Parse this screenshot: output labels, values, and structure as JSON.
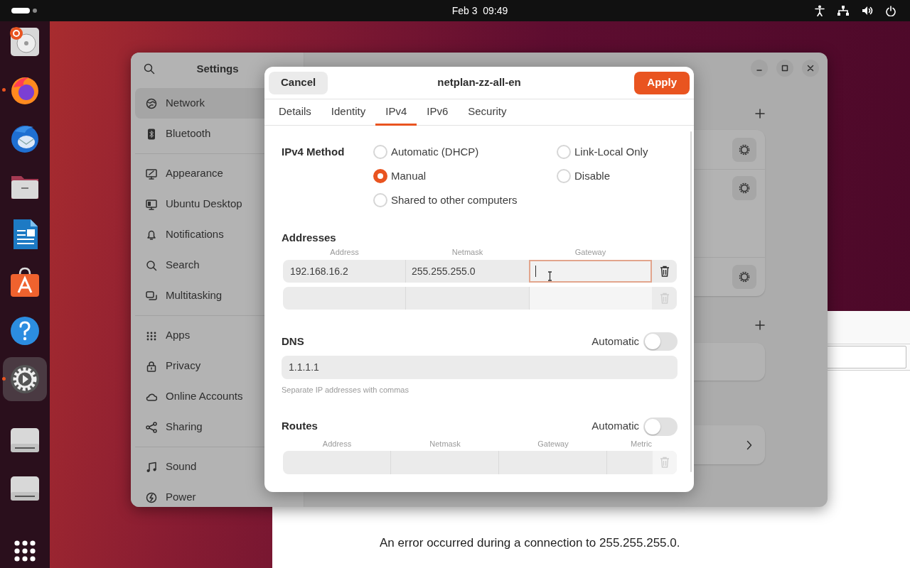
{
  "top_bar": {
    "clock": "Feb 3  09:49"
  },
  "dock": {
    "items": [
      {
        "kind": "installer",
        "running": false,
        "selected": false
      },
      {
        "kind": "browser",
        "running": true,
        "selected": false
      },
      {
        "kind": "mail",
        "running": false,
        "selected": false
      },
      {
        "kind": "files",
        "running": false,
        "selected": false
      },
      {
        "kind": "writer",
        "running": false,
        "selected": false
      },
      {
        "kind": "store",
        "running": false,
        "selected": false
      },
      {
        "kind": "help",
        "running": false,
        "selected": false
      },
      {
        "kind": "settings",
        "running": true,
        "selected": true
      },
      {
        "kind": "drive",
        "running": false,
        "selected": false
      },
      {
        "kind": "drive",
        "running": false,
        "selected": false
      }
    ]
  },
  "browser": {
    "message": "An error occurred during a connection to 255.255.255.0."
  },
  "settings": {
    "title": "Settings",
    "sidebar": {
      "groups": [
        [
          {
            "kind": "network",
            "label": "Network",
            "selected": true
          },
          {
            "kind": "bluetooth",
            "label": "Bluetooth",
            "selected": false
          }
        ],
        [
          {
            "kind": "appearance",
            "label": "Appearance",
            "selected": false
          },
          {
            "kind": "desktop",
            "label": "Ubuntu Desktop",
            "selected": false
          },
          {
            "kind": "notifications",
            "label": "Notifications",
            "selected": false
          },
          {
            "kind": "search",
            "label": "Search",
            "selected": false
          },
          {
            "kind": "multitasking",
            "label": "Multitasking",
            "selected": false
          }
        ],
        [
          {
            "kind": "apps",
            "label": "Apps",
            "selected": false
          },
          {
            "kind": "privacy",
            "label": "Privacy",
            "selected": false
          },
          {
            "kind": "accounts",
            "label": "Online Accounts",
            "selected": false
          },
          {
            "kind": "sharing",
            "label": "Sharing",
            "selected": false
          }
        ],
        [
          {
            "kind": "sound",
            "label": "Sound",
            "selected": false
          },
          {
            "kind": "power",
            "label": "Power",
            "selected": false
          }
        ]
      ]
    }
  },
  "dialog": {
    "cancel": "Cancel",
    "title": "netplan-zz-all-en",
    "apply": "Apply",
    "tabs": [
      {
        "label": "Details",
        "selected": false
      },
      {
        "label": "Identity",
        "selected": false
      },
      {
        "label": "IPv4",
        "selected": true
      },
      {
        "label": "IPv6",
        "selected": false
      },
      {
        "label": "Security",
        "selected": false
      }
    ],
    "method": {
      "label": "IPv4 Method",
      "options": [
        {
          "label": "Automatic (DHCP)",
          "selected": false
        },
        {
          "label": "Link-Local Only",
          "selected": false
        },
        {
          "label": "Manual",
          "selected": true
        },
        {
          "label": "Disable",
          "selected": false
        },
        {
          "label": "Shared to other computers",
          "selected": false
        }
      ]
    },
    "addresses": {
      "title": "Addresses",
      "columns": [
        "Address",
        "Netmask",
        "Gateway"
      ],
      "rows": [
        {
          "address": "192.168.16.2",
          "netmask": "255.255.255.0",
          "gateway_focused": true,
          "delete_disabled": false
        },
        {
          "gateway_focused": false,
          "delete_disabled": true
        }
      ]
    },
    "dns": {
      "title": "DNS",
      "automatic_label": "Automatic",
      "automatic": false,
      "value": "1.1.1.1",
      "hint": "Separate IP addresses with commas"
    },
    "routes": {
      "title": "Routes",
      "automatic_label": "Automatic",
      "automatic": false,
      "columns": [
        "Address",
        "Netmask",
        "Gateway",
        "Metric"
      ],
      "rows": [
        {
          "delete_disabled": true
        }
      ]
    }
  }
}
